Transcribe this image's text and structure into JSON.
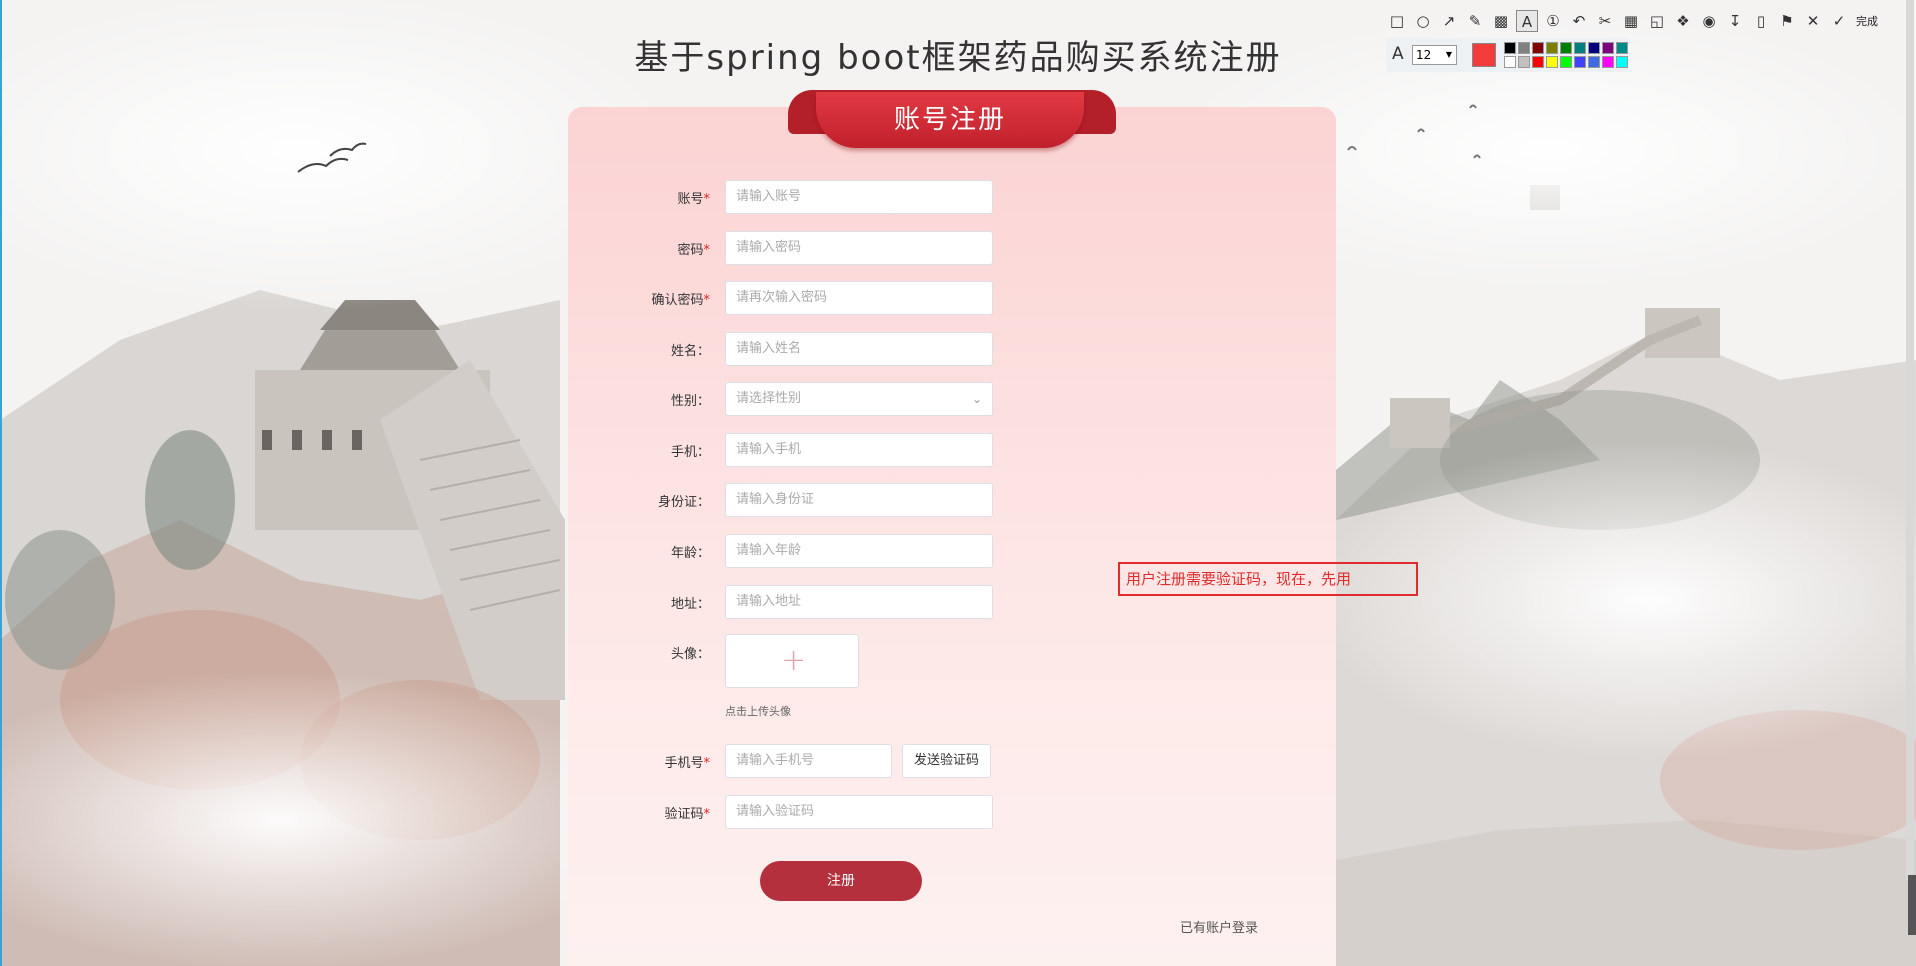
{
  "page": {
    "title": "基于spring boot框架药品购买系统注册"
  },
  "card": {
    "ribbon_title": "账号注册"
  },
  "form": {
    "fields": [
      {
        "label": "账号",
        "required": true,
        "placeholder": "请输入账号"
      },
      {
        "label": "密码",
        "required": true,
        "placeholder": "请输入密码"
      },
      {
        "label": "确认密码",
        "required": true,
        "placeholder": "请再次输入密码"
      },
      {
        "label": "姓名",
        "required": false,
        "placeholder": "请输入姓名"
      },
      {
        "label": "性别",
        "required": false,
        "placeholder": "请选择性别"
      },
      {
        "label": "手机",
        "required": false,
        "placeholder": "请输入手机"
      },
      {
        "label": "身份证",
        "required": false,
        "placeholder": "请输入身份证"
      },
      {
        "label": "年龄",
        "required": false,
        "placeholder": "请输入年龄"
      },
      {
        "label": "地址",
        "required": false,
        "placeholder": "请输入地址"
      }
    ],
    "avatar": {
      "label": "头像",
      "hint": "点击上传头像"
    },
    "phone": {
      "label": "手机号",
      "required": true,
      "placeholder": "请输入手机号",
      "send_button": "发送验证码"
    },
    "code": {
      "label": "验证码",
      "required": true,
      "placeholder": "请输入验证码"
    },
    "submit_button": "注册",
    "login_link": "已有账户登录",
    "colon": "："
  },
  "annotation": {
    "text": "用户注册需要验证码，现在，先用"
  },
  "toolbar": {
    "done_label": "完成",
    "font_size": "12",
    "current_color": "#f23c3c",
    "swatches": [
      "#000000",
      "#808080",
      "#800000",
      "#808000",
      "#008000",
      "#008080",
      "#000080",
      "#800080",
      "#008b8b",
      "#ffffff",
      "#c0c0c0",
      "#ff0000",
      "#ffff00",
      "#00ff00",
      "#4040ff",
      "#4169e1",
      "#ff00ff",
      "#00ffff"
    ]
  }
}
